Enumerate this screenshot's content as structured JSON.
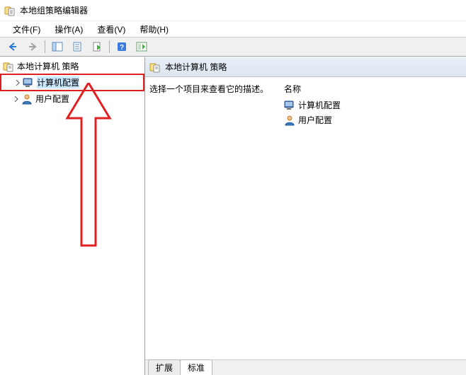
{
  "window": {
    "title": "本地组策略编辑器"
  },
  "menu": {
    "file": "文件(F)",
    "action": "操作(A)",
    "view": "查看(V)",
    "help": "帮助(H)"
  },
  "tree": {
    "root": "本地计算机 策略",
    "children": [
      {
        "label": "计算机配置"
      },
      {
        "label": "用户配置"
      }
    ]
  },
  "right": {
    "header": "本地计算机 策略",
    "descPrompt": "选择一个项目来查看它的描述。",
    "nameHeader": "名称",
    "items": [
      {
        "label": "计算机配置"
      },
      {
        "label": "用户配置"
      }
    ],
    "tabs": {
      "extended": "扩展",
      "standard": "标准"
    }
  }
}
